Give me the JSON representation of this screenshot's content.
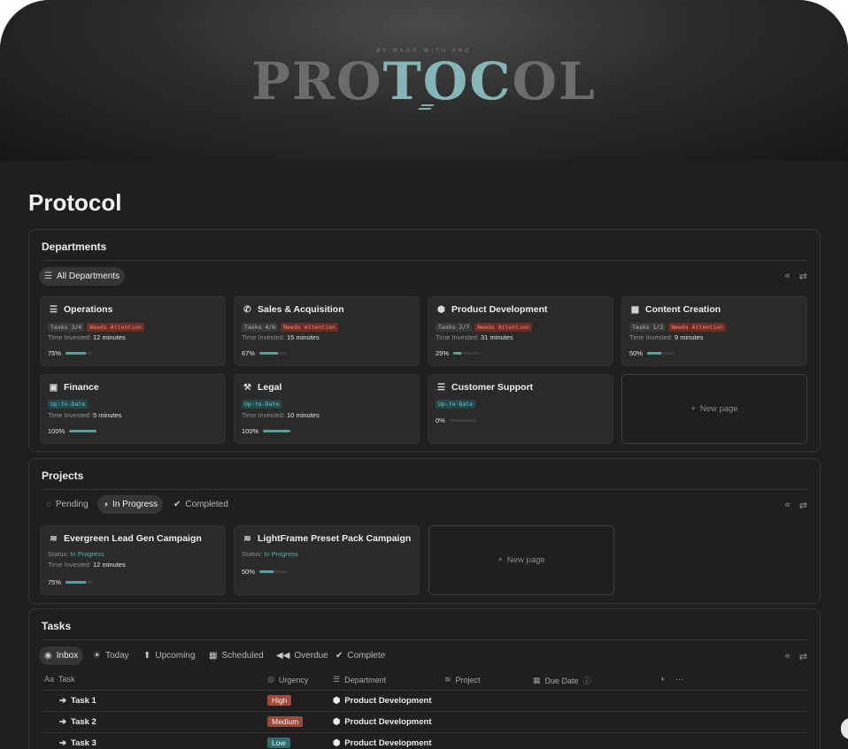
{
  "cover": {
    "eyebrow": "BY MADE WITH PRO",
    "logo_a": "PRO",
    "logo_b": "TOC",
    "logo_c": "OL"
  },
  "page": {
    "title": "Protocol"
  },
  "departments": {
    "title": "Departments",
    "view_tab": "All Departments",
    "cards": [
      {
        "name": "Operations",
        "icon": "list-icon",
        "tasks": "Tasks 3/4",
        "badge": "Needs Attention",
        "badge_color": "#6b2d24",
        "time_label": "Time Invested:",
        "time": "12 minutes",
        "percent": "75%",
        "progress": 0.75
      },
      {
        "name": "Sales & Acquisition",
        "icon": "phone-icon",
        "tasks": "Tasks 4/6",
        "badge": "Needs Attention",
        "badge_color": "#6b2d24",
        "time_label": "Time Invested:",
        "time": "15 minutes",
        "percent": "67%",
        "progress": 0.67
      },
      {
        "name": "Product Development",
        "icon": "cube-icon",
        "tasks": "Tasks 2/7",
        "badge": "Needs Attention",
        "badge_color": "#6b2d24",
        "time_label": "Time Invested:",
        "time": "31 minutes",
        "percent": "29%",
        "progress": 0.29
      },
      {
        "name": "Content Creation",
        "icon": "calendar-icon",
        "tasks": "Tasks 1/2",
        "badge": "Needs Attention",
        "badge_color": "#6b2d24",
        "time_label": "Time Invested:",
        "time": "9 minutes",
        "percent": "50%",
        "progress": 0.5
      },
      {
        "name": "Finance",
        "icon": "money-icon",
        "badge": "Up-to-Date",
        "badge_color": "#21484b",
        "time_label": "Time Invested:",
        "time": "5 minutes",
        "percent": "100%",
        "progress": 1.0
      },
      {
        "name": "Legal",
        "icon": "gavel-icon",
        "badge": "Up-to-Date",
        "badge_color": "#21484b",
        "time_label": "Time Invested:",
        "time": "10 minutes",
        "percent": "100%",
        "progress": 1.0
      },
      {
        "name": "Customer Support",
        "icon": "list-icon",
        "badge": "Up-to-Date",
        "badge_color": "#21484b",
        "percent": "0%",
        "progress": 0.0
      }
    ],
    "new_page": "New page"
  },
  "projects": {
    "title": "Projects",
    "tabs": [
      "Pending",
      "In Progress",
      "Completed"
    ],
    "active_tab": "In Progress",
    "cards": [
      {
        "name": "Evergreen Lead Gen Campaign",
        "status_label": "Status:",
        "status": "In Progress",
        "time_label": "Time Invested:",
        "time": "12 minutes",
        "percent": "75%",
        "progress": 0.75
      },
      {
        "name": "LightFrame Preset Pack Campaign",
        "status_label": "Status:",
        "status": "In Progress",
        "percent": "50%",
        "progress": 0.5
      }
    ],
    "new_page": "New page"
  },
  "tasks": {
    "title": "Tasks",
    "tabs": [
      "Inbox",
      "Today",
      "Upcoming",
      "Scheduled",
      "Overdue",
      "Complete"
    ],
    "active_tab": "Inbox",
    "columns": [
      "Task",
      "Urgency",
      "Department",
      "Project",
      "Due Date"
    ],
    "rows": [
      {
        "task": "Task 1",
        "urgency": "High",
        "urgency_color": "#a34a38",
        "department": "Product Development"
      },
      {
        "task": "Task 2",
        "urgency": "Medium",
        "urgency_color": "#9a4a3a",
        "department": "Product Development"
      },
      {
        "task": "Task 3",
        "urgency": "Low",
        "urgency_color": "#2e6c6e",
        "department": "Product Development"
      }
    ]
  },
  "colors": {
    "accent": "#57a0a0",
    "background": "#1e1e1e",
    "card": "#2a2a2a"
  }
}
